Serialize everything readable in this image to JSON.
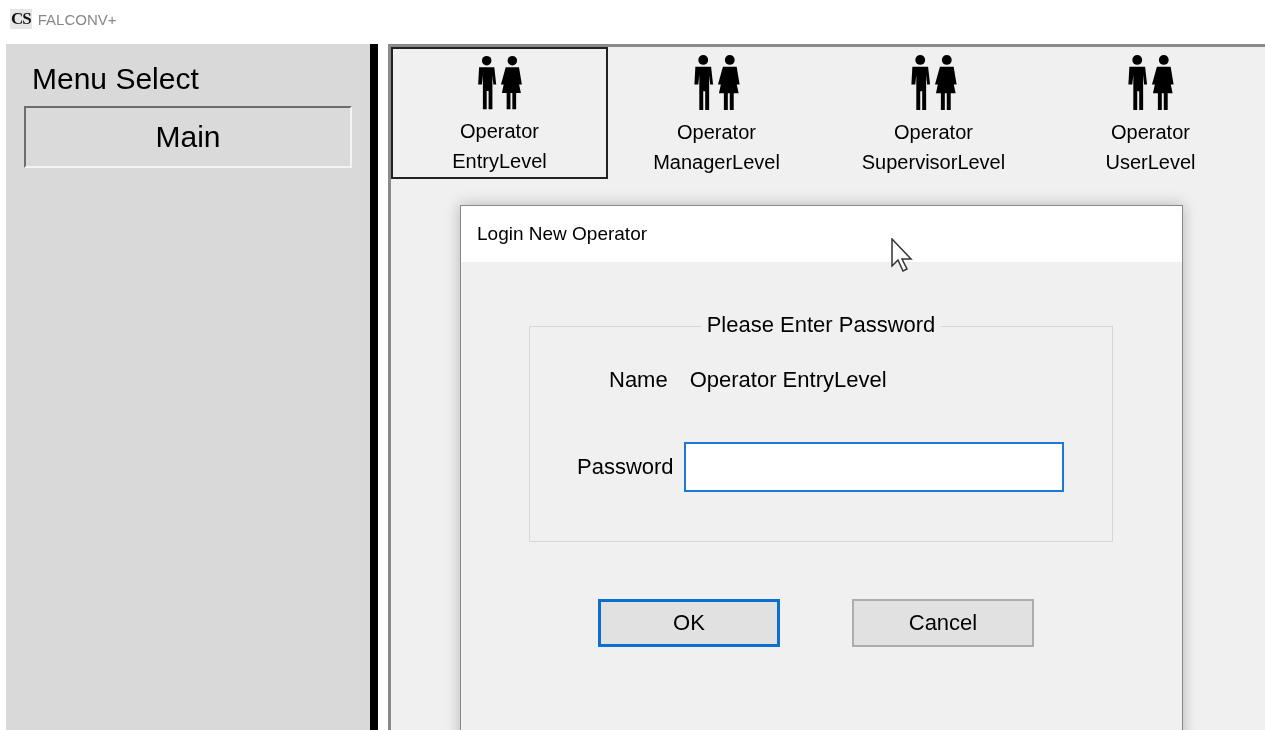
{
  "window": {
    "logo": "CS",
    "title": "FALCONV+"
  },
  "sidebar": {
    "title": "Menu Select",
    "items": [
      {
        "label": "Main",
        "selected": true
      }
    ]
  },
  "operators": [
    {
      "label": "Operator\nEntryLevel",
      "selected": true
    },
    {
      "label": "Operator\nManagerLevel",
      "selected": false
    },
    {
      "label": "Operator\nSupervisorLevel",
      "selected": false
    },
    {
      "label": "Operator\nUserLevel",
      "selected": false
    }
  ],
  "dialog": {
    "title": "Login New Operator",
    "group_title": "Please Enter Password",
    "name_label": "Name",
    "name_value": "Operator EntryLevel",
    "password_label": "Password",
    "password_focused": true,
    "buttons": [
      {
        "label": "OK",
        "focused": true
      },
      {
        "label": "Cancel",
        "focused": false
      }
    ]
  }
}
